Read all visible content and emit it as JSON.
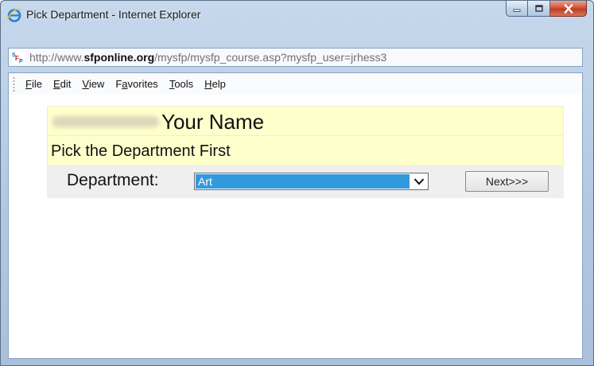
{
  "window": {
    "title": "Pick Department - Internet Explorer"
  },
  "address": {
    "scheme": "http://www.",
    "domain": "sfponline.org",
    "path": "/mysfp/mysfp_course.asp?mysfp_user=jrhess3",
    "favicon_text": "SFP"
  },
  "menu": {
    "items": [
      {
        "accel": "F",
        "rest": "ile"
      },
      {
        "accel": "E",
        "rest": "dit"
      },
      {
        "accel": "V",
        "rest": "iew"
      },
      {
        "accel": "a",
        "pre": "F",
        "rest": "vorites"
      },
      {
        "accel": "T",
        "rest": "ools"
      },
      {
        "accel": "H",
        "rest": "elp"
      }
    ]
  },
  "page": {
    "name_label": "Your Name",
    "instruction": "Pick the Department First",
    "department_label": "Department:",
    "department_selected": "Art",
    "next_label": "Next>>>"
  },
  "colors": {
    "highlight_row": "#ffffcc",
    "form_row": "#efefef",
    "select_highlight": "#3399dd"
  }
}
